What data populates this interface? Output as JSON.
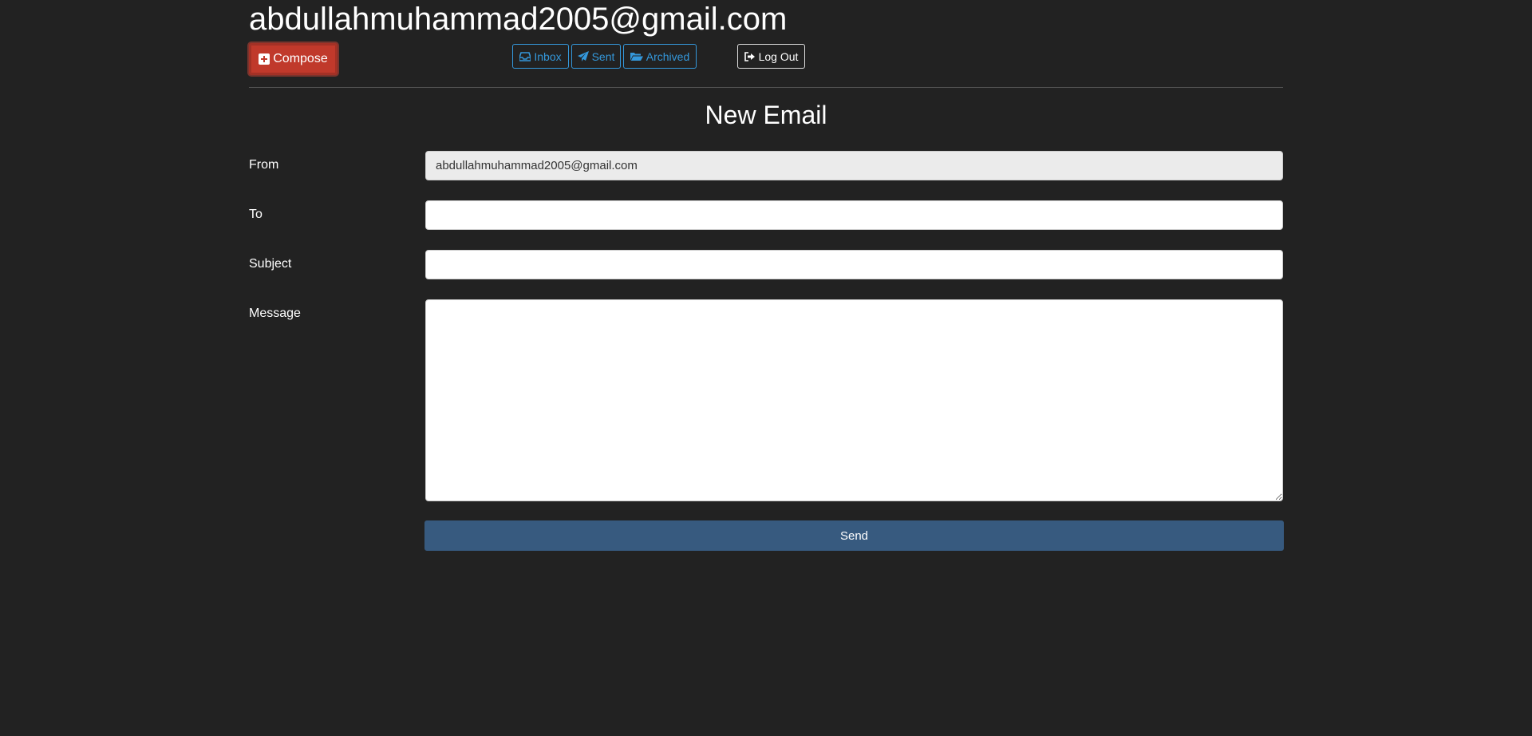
{
  "header": {
    "user_email": "abdullahmuhammad2005@gmail.com"
  },
  "toolbar": {
    "compose_label": "Compose",
    "inbox_label": "Inbox",
    "sent_label": "Sent",
    "archived_label": "Archived",
    "logout_label": "Log Out"
  },
  "icons": {
    "compose": "plus-square-icon",
    "inbox": "inbox-icon",
    "sent": "paper-plane-icon",
    "archived": "folder-open-icon",
    "logout": "sign-out-icon"
  },
  "form": {
    "title": "New Email",
    "from_label": "From",
    "from_value": "abdullahmuhammad2005@gmail.com",
    "to_label": "To",
    "to_value": "",
    "subject_label": "Subject",
    "subject_value": "",
    "message_label": "Message",
    "message_value": "",
    "send_label": "Send"
  },
  "colors": {
    "background": "#222222",
    "compose": "#c0392b",
    "nav_accent": "#3498db",
    "send": "#375a7f"
  }
}
